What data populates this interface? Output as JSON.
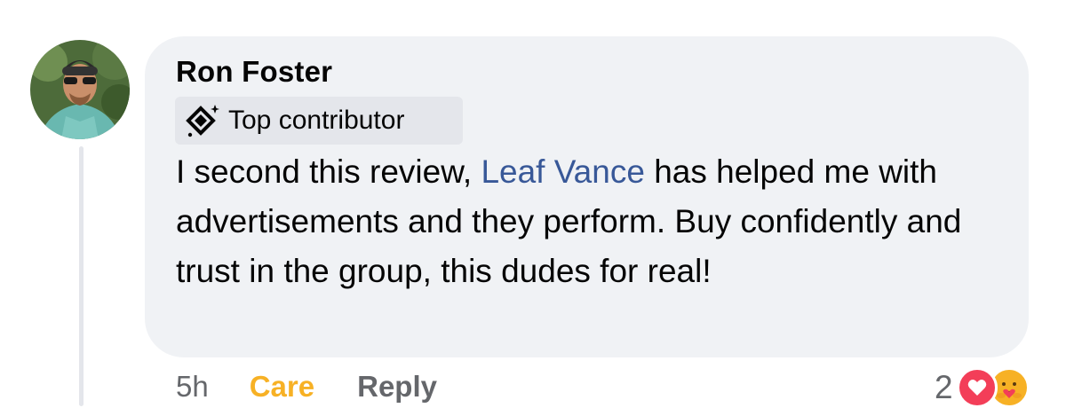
{
  "comment": {
    "author": "Ron Foster",
    "badge": {
      "label": "Top contributor",
      "icon": "diamond-sparkle-icon"
    },
    "text_before": "I second this review, ",
    "mention": "Leaf Vance",
    "text_after": " has helped me with advertisements and they perform.  Buy confidently and trust in the group, this dudes for real!",
    "timestamp": "5h",
    "reaction_label": "Care",
    "reply_label": "Reply",
    "reaction_count": "2",
    "reactions": [
      "love-icon",
      "care-icon"
    ]
  },
  "colors": {
    "bubble": "#f0f2f5",
    "mention": "#385898",
    "care": "#f7b125",
    "secondary_text": "#65676b",
    "love": "#f33e58"
  }
}
